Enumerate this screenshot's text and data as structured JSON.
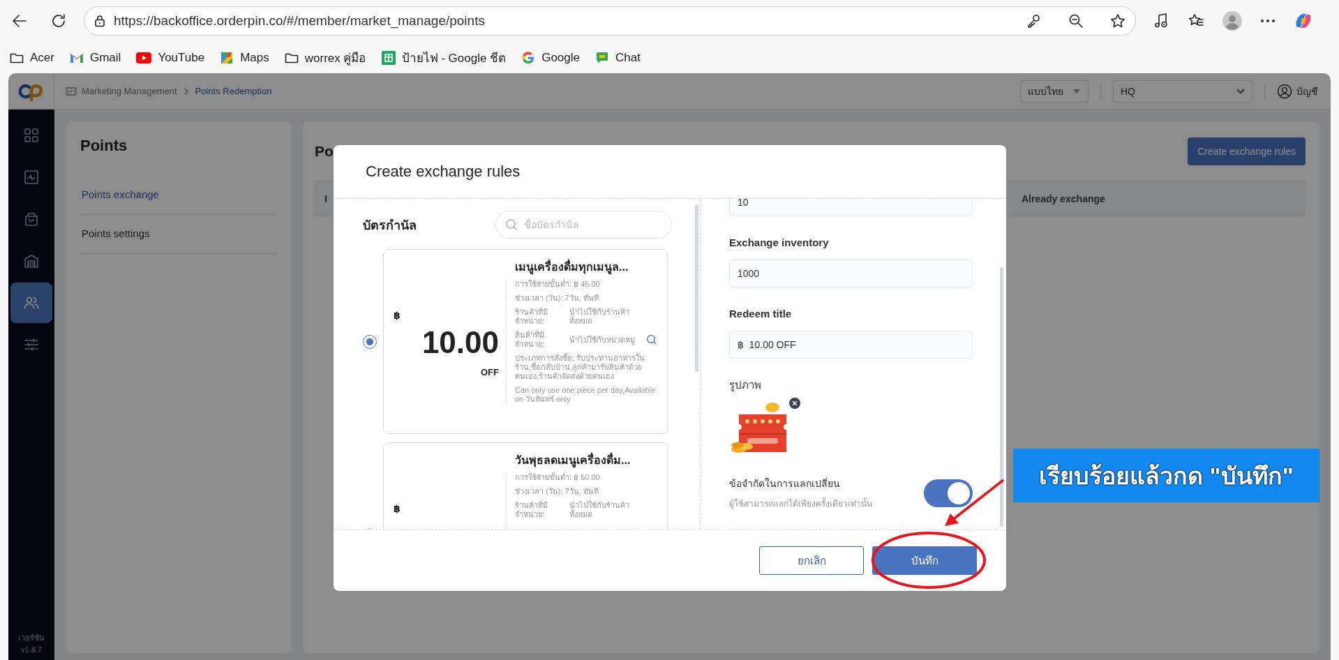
{
  "browser": {
    "url": "https://backoffice.orderpin.co/#/member/market_manage/points",
    "bookmarks": [
      {
        "kind": "folder",
        "label": "Acer"
      },
      {
        "kind": "gmail",
        "label": "Gmail"
      },
      {
        "kind": "youtube",
        "label": "YouTube"
      },
      {
        "kind": "maps",
        "label": "Maps"
      },
      {
        "kind": "folder",
        "label": "worrex คู่มือ"
      },
      {
        "kind": "sheets",
        "label": "ป้ายไฟ - Google ชีต"
      },
      {
        "kind": "google",
        "label": "Google"
      },
      {
        "kind": "chat",
        "label": "Chat"
      }
    ]
  },
  "app": {
    "breadcrumb": [
      "Marketing Management",
      "Points Redemption"
    ],
    "language": "แบบไทย",
    "store": "HQ",
    "account": "บัญชี",
    "nav": [
      {
        "kind": "grid",
        "selected": false
      },
      {
        "kind": "activity",
        "selected": false
      },
      {
        "kind": "bag",
        "selected": false
      },
      {
        "kind": "building",
        "selected": false
      },
      {
        "kind": "users",
        "selected": true
      },
      {
        "kind": "sliders",
        "selected": false
      }
    ],
    "version_label": "เวอร์ชัน",
    "version": "v1.8.7"
  },
  "side_panel": {
    "title": "Points",
    "items": [
      {
        "label": "Points exchange",
        "selected": true
      },
      {
        "label": "Points settings",
        "selected": false
      }
    ]
  },
  "main": {
    "title": "Po",
    "create_button": "Create exchange rules",
    "columns": [
      "I",
      "Already exchange"
    ]
  },
  "modal": {
    "title": "Create exchange rules",
    "coupon_heading": "บัตรกำนัล",
    "search_placeholder": "ชื่อบัตรกำนัล",
    "coupons": [
      {
        "selected": true,
        "currency": "฿",
        "amount": "10.00",
        "unit": "OFF",
        "title": "เมนูเครื่องดื่มทุกเมนูล...",
        "lines": [
          {
            "kind": "text",
            "text": "การใช้จ่ายขั้นต่ำ: ฿ 45.00"
          },
          {
            "kind": "text",
            "text": "ช่วงเวลา (วัน): 7วัน, ทันที"
          },
          {
            "kind": "pair",
            "label": "ร้านค้าที่มี จำหน่าย:",
            "value": "นำไปใช้กับร้านค้าทั้งหมด",
            "search": false
          },
          {
            "kind": "pair",
            "label": "สินค้าที่มี จำหน่าย:",
            "value": "นำไปใช้กับหมวดหมู่",
            "search": true
          },
          {
            "kind": "text",
            "text": "ประเภทการสั่งซื้อ: รับประทานอาหารในร้าน,ซื้อกลับบ้าน,ลูกค้ามารับสินค้าด้วยตนเอง,ร้านค้าจัดส่งด้วยตนเอง"
          },
          {
            "kind": "text",
            "text": "Can only use one piece per day,Available on วันจันทร์ only"
          }
        ]
      },
      {
        "selected": false,
        "currency": "฿",
        "title": "วันพุธลดเมนูเครื่องดื่ม...",
        "lines": [
          {
            "kind": "text",
            "text": "การใช้จ่ายขั้นต่ำ: ฿ 50.00"
          },
          {
            "kind": "text",
            "text": "ช่วงเวลา (วัน): 7วัน, ทันที"
          },
          {
            "kind": "pair",
            "label": "ร้านค้าที่มี จำหน่าย:",
            "value": "นำไปใช้กับร้านค้าทั้งหมด",
            "search": false
          }
        ]
      }
    ],
    "fields": [
      {
        "value": "10"
      },
      {
        "label": "Exchange inventory",
        "value": "1000"
      },
      {
        "label": "Redeem title",
        "value": "฿  10.00 OFF"
      }
    ],
    "image_label": "รูปภาพ",
    "limit": {
      "label": "ข้อจำกัดในการแลกเปลี่ยน",
      "description": "ผู้ใช้สามารถแลกได้เพียงครั้งเดียวเท่านั้น",
      "on": true
    },
    "buttons": {
      "cancel": "ยกเลิก",
      "save": "บันทึก"
    }
  },
  "annotation": {
    "text": "เรียบร้อยแล้วกด \"บันทึก\""
  }
}
